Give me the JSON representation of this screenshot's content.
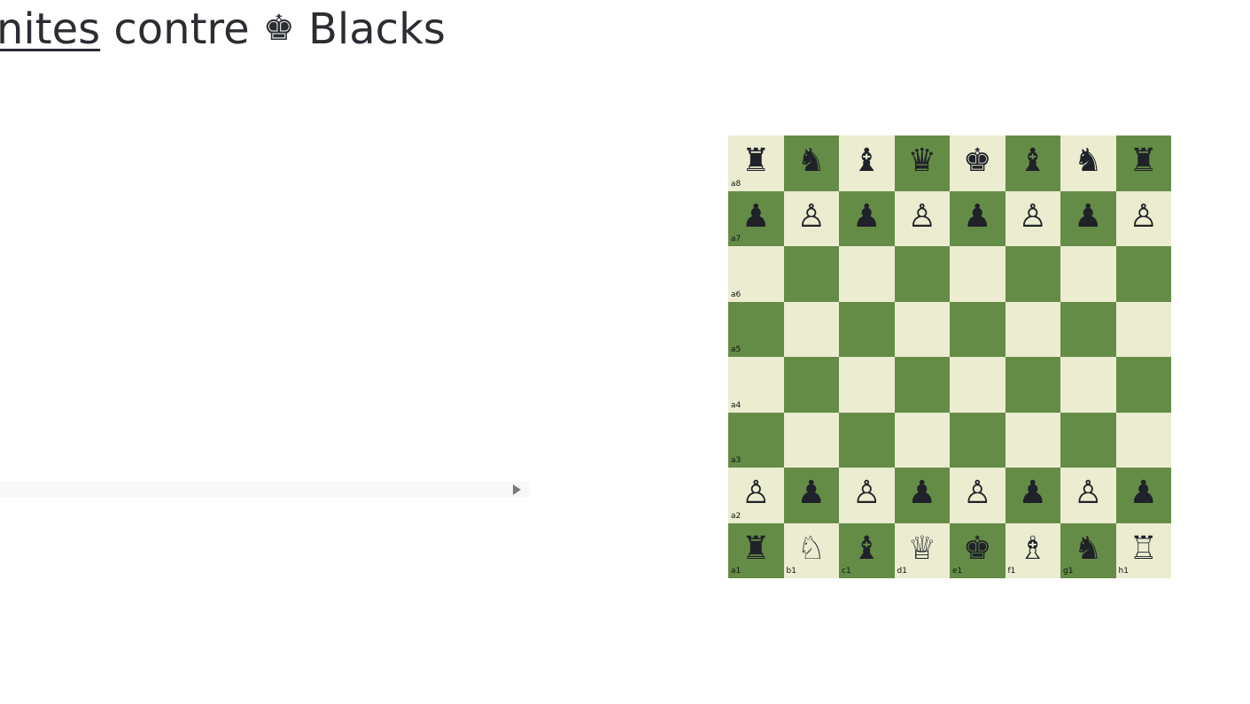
{
  "game": {
    "title_left_link": "nites",
    "title_middle": "contre",
    "title_king": "♚",
    "title_right": "Blacks"
  },
  "colors": {
    "light_square": "#ebecd0",
    "dark_square": "#658c47",
    "piece": "#1f2228"
  },
  "board": {
    "files": [
      "a",
      "b",
      "c",
      "d",
      "e",
      "f",
      "g",
      "h"
    ],
    "ranks": [
      8,
      7,
      6,
      5,
      4,
      3,
      2,
      1
    ],
    "rank_labels": [
      "a8",
      "a7",
      "a6",
      "a5",
      "a4",
      "a3",
      "a2",
      "a1"
    ],
    "file_labels": [
      "a1",
      "b1",
      "c1",
      "d1",
      "e1",
      "f1",
      "g1",
      "h1"
    ],
    "position": [
      [
        "♜",
        "♞",
        "♝",
        "♛",
        "♚",
        "♝",
        "♞",
        "♜"
      ],
      [
        "♟",
        "♙",
        "♟",
        "♙",
        "♟",
        "♙",
        "♟",
        "♙"
      ],
      [
        "",
        "",
        "",
        "",
        "",
        "",
        "",
        ""
      ],
      [
        "",
        "",
        "",
        "",
        "",
        "",
        "",
        ""
      ],
      [
        "",
        "",
        "",
        "",
        "",
        "",
        "",
        ""
      ],
      [
        "",
        "",
        "",
        "",
        "",
        "",
        "",
        ""
      ],
      [
        "♙",
        "♟",
        "♙",
        "♟",
        "♙",
        "♟",
        "♙",
        "♟"
      ],
      [
        "♜",
        "♘",
        "♝",
        "♕",
        "♚",
        "♗",
        "♞",
        "♖"
      ]
    ]
  },
  "scrollbar": {
    "arrow_icon": "arrow-right-icon"
  }
}
